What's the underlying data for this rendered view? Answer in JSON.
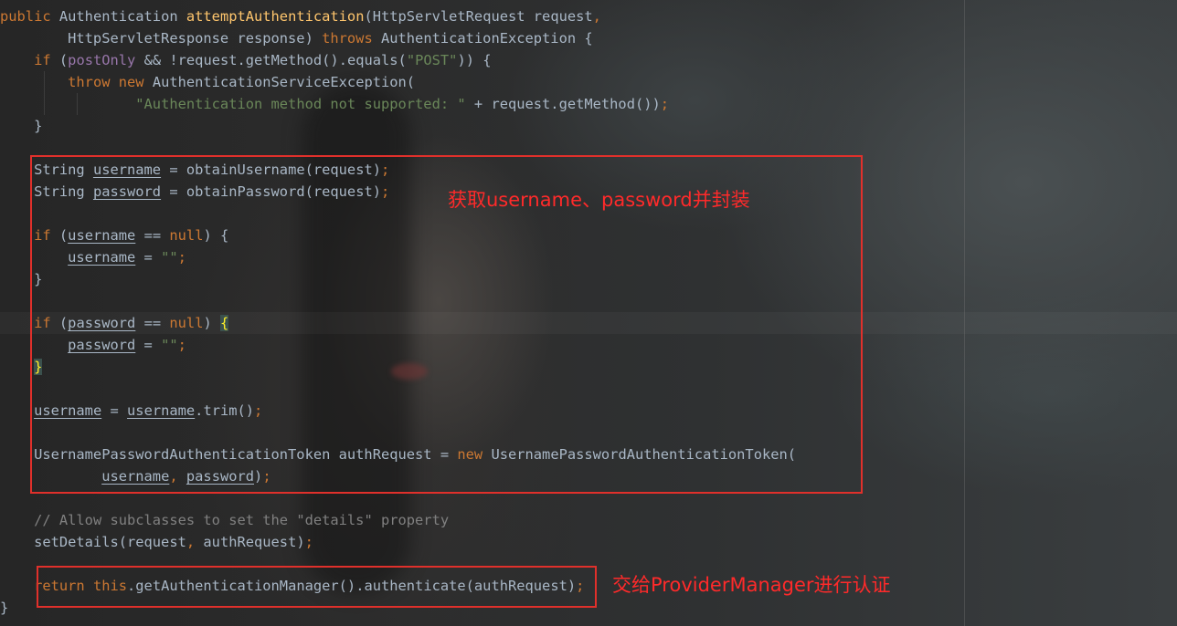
{
  "code_lines": [
    [
      {
        "t": "public ",
        "c": "kw"
      },
      {
        "t": "Authentication "
      },
      {
        "t": "attemptAuthentication",
        "c": "fn"
      },
      {
        "t": "(HttpServletRequest request"
      },
      {
        "t": ",",
        "c": "kw"
      }
    ],
    [
      {
        "t": "        HttpServletResponse response) "
      },
      {
        "t": "throws ",
        "c": "kw"
      },
      {
        "t": "AuthenticationException {"
      }
    ],
    [
      {
        "t": "    "
      },
      {
        "t": "if ",
        "c": "kw"
      },
      {
        "t": "("
      },
      {
        "t": "postOnly",
        "c": "fld"
      },
      {
        "t": " && !request.getMethod().equals("
      },
      {
        "t": "\"POST\"",
        "c": "str"
      },
      {
        "t": ")) {"
      }
    ],
    [
      {
        "t": "        "
      },
      {
        "t": "throw new ",
        "c": "kw"
      },
      {
        "t": "AuthenticationServiceException("
      }
    ],
    [
      {
        "t": "                "
      },
      {
        "t": "\"Authentication method not supported: \"",
        "c": "str"
      },
      {
        "t": " + request.getMethod())"
      },
      {
        "t": ";",
        "c": "kw"
      }
    ],
    [
      {
        "t": "    }"
      }
    ],
    [],
    [
      {
        "t": "    String "
      },
      {
        "t": "username",
        "c": "ul"
      },
      {
        "t": " = obtainUsername(request)"
      },
      {
        "t": ";",
        "c": "kw"
      }
    ],
    [
      {
        "t": "    String "
      },
      {
        "t": "password",
        "c": "ul"
      },
      {
        "t": " = obtainPassword(request)"
      },
      {
        "t": ";",
        "c": "kw"
      }
    ],
    [],
    [
      {
        "t": "    "
      },
      {
        "t": "if ",
        "c": "kw"
      },
      {
        "t": "("
      },
      {
        "t": "username",
        "c": "ul"
      },
      {
        "t": " == "
      },
      {
        "t": "null",
        "c": "kw"
      },
      {
        "t": ") {"
      }
    ],
    [
      {
        "t": "        "
      },
      {
        "t": "username",
        "c": "ul"
      },
      {
        "t": " = "
      },
      {
        "t": "\"\"",
        "c": "str"
      },
      {
        "t": ";",
        "c": "kw"
      }
    ],
    [
      {
        "t": "    }"
      }
    ],
    [],
    [
      {
        "t": "    "
      },
      {
        "t": "if ",
        "c": "kw"
      },
      {
        "t": "("
      },
      {
        "t": "password",
        "c": "ul"
      },
      {
        "t": " == "
      },
      {
        "t": "null",
        "c": "kw"
      },
      {
        "t": ") "
      },
      {
        "t": "{",
        "c": "brace-hl"
      }
    ],
    [
      {
        "t": "        "
      },
      {
        "t": "password",
        "c": "ul"
      },
      {
        "t": " = "
      },
      {
        "t": "\"\"",
        "c": "str"
      },
      {
        "t": ";",
        "c": "kw"
      }
    ],
    [
      {
        "t": "    "
      },
      {
        "t": "}",
        "c": "brace-hl"
      }
    ],
    [],
    [
      {
        "t": "    "
      },
      {
        "t": "username",
        "c": "ul"
      },
      {
        "t": " = "
      },
      {
        "t": "username",
        "c": "ul"
      },
      {
        "t": ".trim()"
      },
      {
        "t": ";",
        "c": "kw"
      }
    ],
    [],
    [
      {
        "t": "    UsernamePasswordAuthenticationToken authRequest = "
      },
      {
        "t": "new ",
        "c": "kw"
      },
      {
        "t": "UsernamePasswordAuthenticationToken("
      }
    ],
    [
      {
        "t": "            "
      },
      {
        "t": "username",
        "c": "ul"
      },
      {
        "t": ", ",
        "c": "kw"
      },
      {
        "t": "password",
        "c": "ul"
      },
      {
        "t": ")"
      },
      {
        "t": ";",
        "c": "kw"
      }
    ],
    [],
    [
      {
        "t": "    "
      },
      {
        "t": "// Allow subclasses to set the \"details\" property",
        "c": "cmt"
      }
    ],
    [
      {
        "t": "    setDetails(request"
      },
      {
        "t": ", ",
        "c": "kw"
      },
      {
        "t": "authRequest)"
      },
      {
        "t": ";",
        "c": "kw"
      }
    ],
    [],
    [
      {
        "t": "    "
      },
      {
        "t": "return this",
        "c": "kw"
      },
      {
        "t": ".getAuthenticationManager().authenticate(authRequest)"
      },
      {
        "t": ";",
        "c": "kw"
      }
    ],
    [
      {
        "t": "}"
      }
    ]
  ],
  "annotations": {
    "box1_label": "获取username、password并封装",
    "box2_label": "交给ProviderManager进行认证"
  },
  "colors": {
    "keyword": "#cc7832",
    "function": "#ffc66d",
    "string": "#6a8759",
    "field": "#9876aa",
    "comment": "#808080",
    "text": "#a9b7c6",
    "annotation": "#e0302b"
  }
}
